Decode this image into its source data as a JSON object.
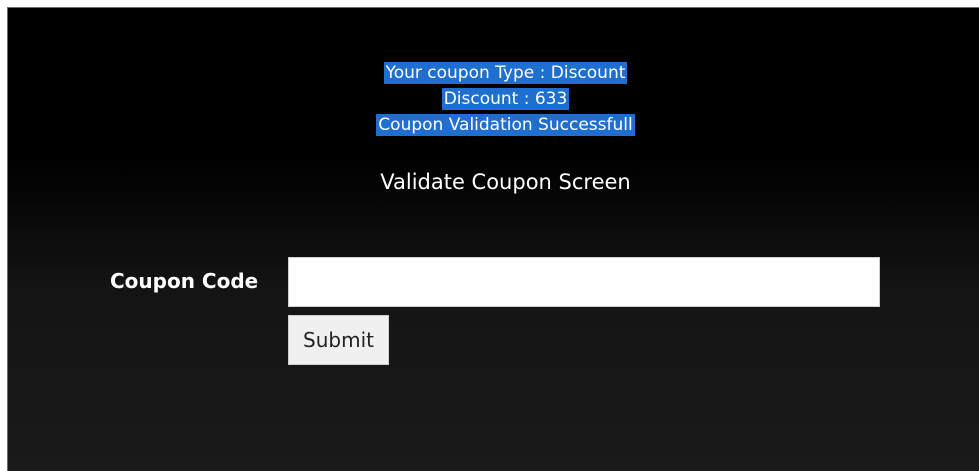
{
  "messages": {
    "coupon_type": "Your coupon Type : Discount",
    "discount": "Discount : 633",
    "status": "Coupon Validation Successfull"
  },
  "title": "Validate Coupon Screen",
  "form": {
    "coupon_label": "Coupon Code",
    "coupon_value": "",
    "submit_label": "Submit"
  },
  "colors": {
    "highlight": "#1e6fd0",
    "background": "#000000"
  }
}
